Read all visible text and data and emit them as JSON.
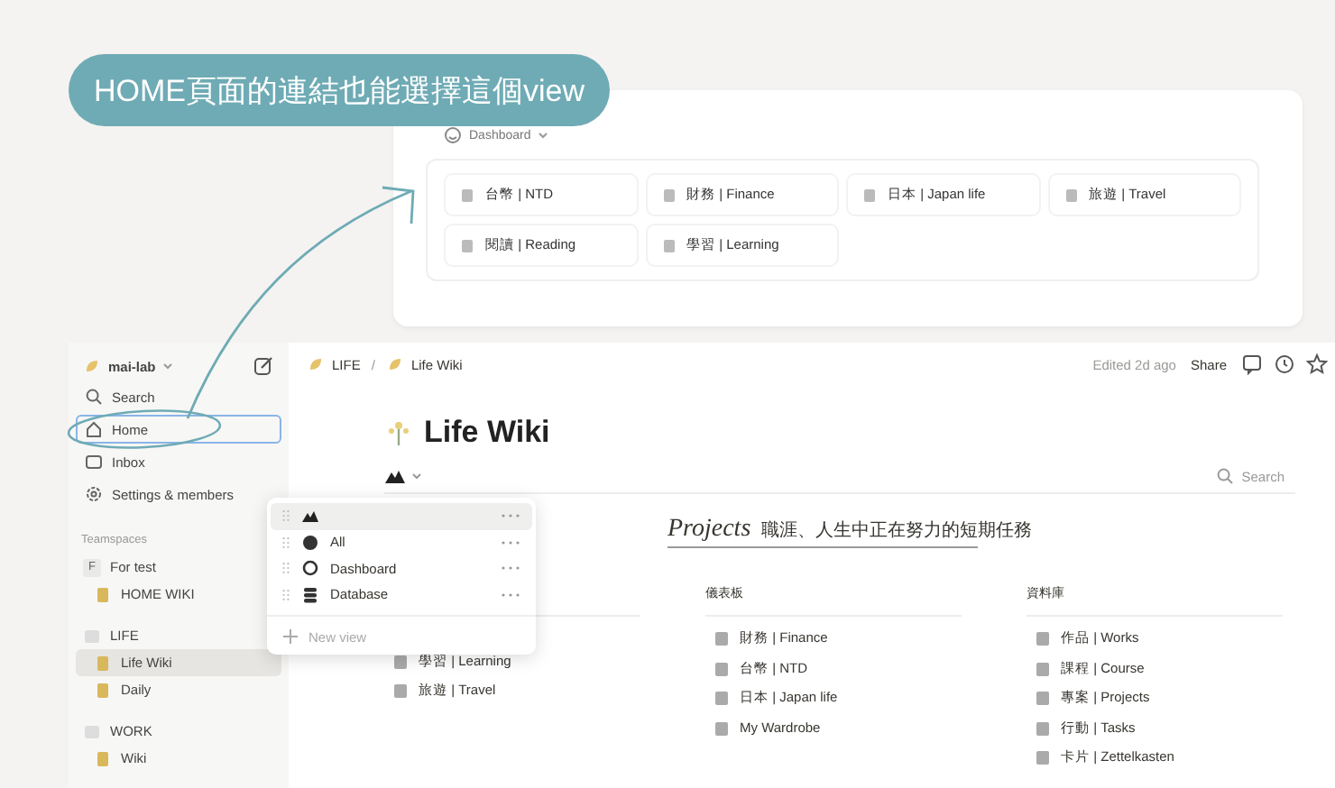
{
  "callout": {
    "text": "HOME頁面的連結也能選擇這個view"
  },
  "dashboard_preview": {
    "view_label": "Dashboard",
    "tiles": [
      {
        "label": "台幣 | NTD"
      },
      {
        "label": "財務 | Finance"
      },
      {
        "label": "日本 | Japan life"
      },
      {
        "label": "旅遊 | Travel"
      },
      {
        "label": "閱讀 | Reading"
      },
      {
        "label": "學習 | Learning"
      }
    ]
  },
  "sidebar": {
    "workspace": "mai-lab",
    "nav": [
      {
        "label": "Search",
        "focused": false
      },
      {
        "label": "Home",
        "focused": true
      },
      {
        "label": "Inbox",
        "focused": false
      },
      {
        "label": "Settings & members",
        "focused": false
      }
    ],
    "teamspaces": {
      "heading": "Teamspaces",
      "items": [
        {
          "label": "For test",
          "badge": "F",
          "selected": false,
          "children": [
            {
              "label": "HOME WIKI",
              "selected": false
            }
          ]
        },
        {
          "label": "LIFE",
          "selected": false,
          "children": [
            {
              "label": "Life Wiki",
              "selected": true
            },
            {
              "label": "Daily",
              "selected": false
            }
          ]
        },
        {
          "label": "WORK",
          "selected": false,
          "children": [
            {
              "label": "Wiki",
              "selected": false
            }
          ]
        }
      ]
    }
  },
  "topbar": {
    "breadcrumb": [
      "LIFE",
      "Life Wiki"
    ],
    "separator": "/",
    "edited": "Edited 2d ago",
    "share": "Share"
  },
  "page": {
    "title": "Life Wiki",
    "search": "Search",
    "projects": {
      "title": "Projects",
      "subtitle": "職涯、人生中正在努力的短期任務"
    },
    "columns": [
      {
        "items": [
          {
            "label": "學習 | Learning"
          },
          {
            "label": "旅遊 | Travel"
          }
        ]
      },
      {
        "heading": "儀表板",
        "items": [
          {
            "label": "財務 | Finance"
          },
          {
            "label": "台幣 | NTD"
          },
          {
            "label": "日本 | Japan life"
          },
          {
            "label": "My Wardrobe"
          }
        ]
      },
      {
        "heading": "資料庫",
        "items": [
          {
            "label": "作品 | Works"
          },
          {
            "label": "課程 | Course"
          },
          {
            "label": "專案 | Projects"
          },
          {
            "label": "行動 | Tasks"
          },
          {
            "label": "卡片 | Zettelkasten"
          }
        ]
      }
    ]
  },
  "view_menu": {
    "items": [
      {
        "selected": true
      },
      {
        "label": "All",
        "selected": false
      },
      {
        "label": "Dashboard",
        "selected": false
      },
      {
        "label": "Database",
        "selected": false
      }
    ],
    "new_view": "New view"
  }
}
